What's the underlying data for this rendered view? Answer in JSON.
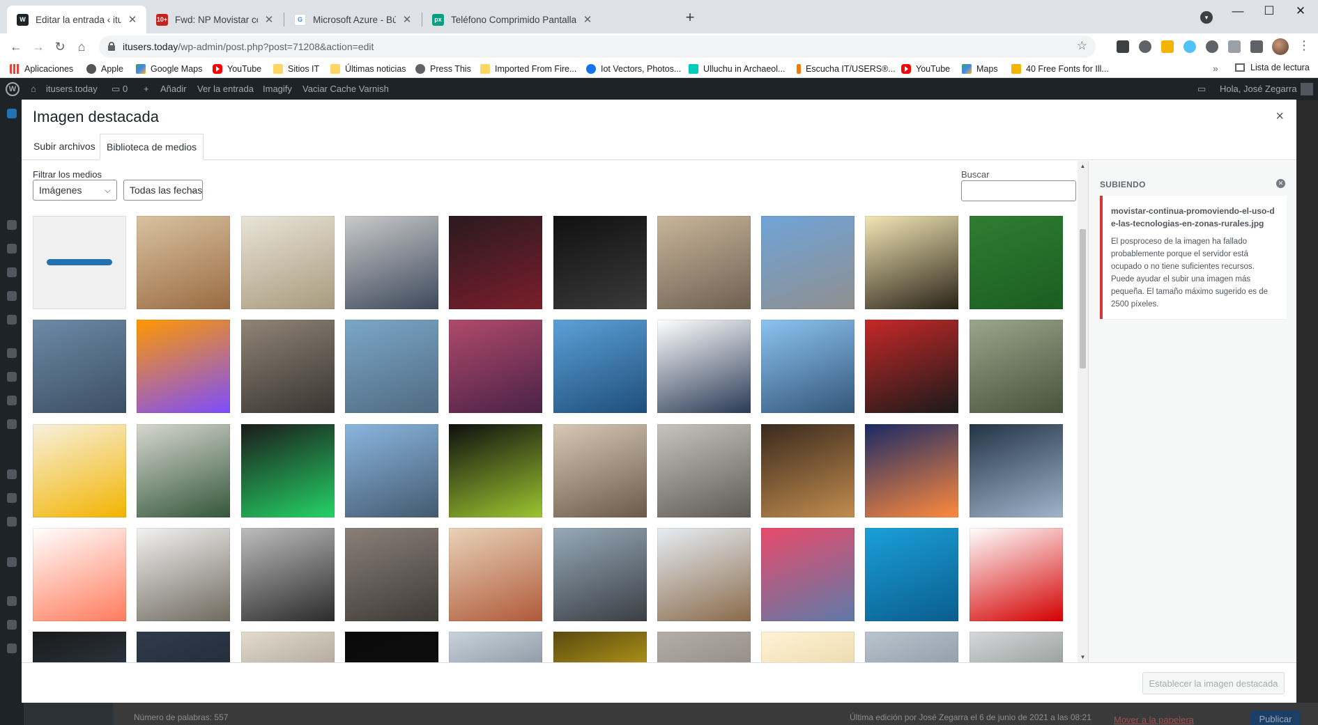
{
  "browser": {
    "tabs": [
      {
        "title": "Editar la entrada ‹ itusers.today",
        "favicon_color": "#1d2327",
        "favicon_text": "",
        "active": true
      },
      {
        "title": "Fwd: NP Movistar continúa promoviendo",
        "favicon_color": "#c5221f",
        "favicon_text": "10+",
        "active": false
      },
      {
        "title": "Microsoft Azure - Búsqueda de Google",
        "favicon_color": "#ffffff",
        "favicon_text": "G",
        "active": false
      },
      {
        "title": "Teléfono Comprimido Pantalla - Foto",
        "favicon_color": "#05a081",
        "favicon_text": "px",
        "active": false
      }
    ],
    "new_tab": "+",
    "window_controls": {
      "minimize": "—",
      "maximize": "☐",
      "close": "✕"
    },
    "url_host": "itusers.today",
    "url_path": "/wp-admin/post.php?post=71208&action=edit",
    "bookmarks": [
      {
        "label": "Aplicaciones",
        "icon": "apps"
      },
      {
        "label": "Apple",
        "icon": "apple"
      },
      {
        "label": "Google Maps",
        "icon": "maps"
      },
      {
        "label": "YouTube",
        "icon": "yt"
      },
      {
        "label": "Sitios IT",
        "icon": "folder"
      },
      {
        "label": "Últimas noticias",
        "icon": "folder"
      },
      {
        "label": "Press This",
        "icon": "globe"
      },
      {
        "label": "Imported From Fire...",
        "icon": "folder"
      },
      {
        "label": "Iot Vectors, Photos...",
        "icon": "freepik"
      },
      {
        "label": "Ulluchu in Archaeol...",
        "icon": "researchgate"
      },
      {
        "label": "Escucha IT/USERS®...",
        "icon": "ivoox"
      },
      {
        "label": "YouTube",
        "icon": "yt"
      },
      {
        "label": "Maps",
        "icon": "maps"
      },
      {
        "label": "40 Free Fonts for Ill...",
        "icon": "fonts"
      }
    ],
    "bookmarks_more": "»",
    "reading_list": "Lista de lectura"
  },
  "wp_admin": {
    "site_name": "itusers.today",
    "comments_count": "0",
    "add_new": "Añadir",
    "view_post": "Ver la entrada",
    "imagify": "Imagify",
    "varnish": "Vaciar Cache Varnish",
    "greeting": "Hola, José Zegarra",
    "word_count": "Número de palabras: 557",
    "last_edit": "Última edición por José Zegarra el 6 de junio de 2021 a las 08:21",
    "trash": "Mover a la papelera",
    "publish": "Publicar"
  },
  "modal": {
    "title": "Imagen destacada",
    "close": "×",
    "tabs": [
      "Subir archivos",
      "Biblioteca de medios"
    ],
    "active_tab": 1,
    "filter_label": "Filtrar los medios",
    "type_filter": "Imágenes",
    "date_filter": "Todas las fechas",
    "search_label": "Buscar",
    "search_value": "",
    "set_button": "Establecer la imagen destacada"
  },
  "upload_panel": {
    "heading": "SUBIENDO",
    "filename": "movistar-continua-promoviendo-el-uso-de-las-tecnologias-en-zonas-rurales.jpg",
    "message": "El posproceso de la imagen ha fallado probablemente porque el servidor está ocupado o no tiene suficientes recursos. Puede ayudar el subir una imagen más pequeña. El tamaño máximo sugerido es de 2500 píxeles."
  },
  "media_items": [
    {
      "subject": "loading-bar",
      "colors": [
        "#f0f0f1",
        "#f0f0f1"
      ]
    },
    {
      "subject": "desk-with-phones",
      "colors": [
        "#d9c2a0",
        "#9a6b42"
      ]
    },
    {
      "subject": "boy-with-laptop",
      "colors": [
        "#e9e4d8",
        "#a89a7d"
      ]
    },
    {
      "subject": "man-portrait",
      "colors": [
        "#c9c9c9",
        "#3d4a5c"
      ]
    },
    {
      "subject": "man-with-phone-icons",
      "colors": [
        "#2a1a20",
        "#7a1e2b"
      ]
    },
    {
      "subject": "hand-touching-icons",
      "colors": [
        "#111111",
        "#3a3a3a"
      ]
    },
    {
      "subject": "aerial-city-smoke",
      "colors": [
        "#c9b59a",
        "#6e6052"
      ]
    },
    {
      "subject": "sap-building",
      "colors": [
        "#6fa3d8",
        "#8f8f8f"
      ]
    },
    {
      "subject": "photographer-silhouette",
      "colors": [
        "#f3e6b5",
        "#2a2418"
      ]
    },
    {
      "subject": "amazon-river",
      "colors": [
        "#2e7d32",
        "#1b5e20"
      ]
    },
    {
      "subject": "man-climbing",
      "colors": [
        "#6d8aa8",
        "#3c4f63"
      ]
    },
    {
      "subject": "iot-bubbles",
      "colors": [
        "#ff9800",
        "#7c4dff"
      ]
    },
    {
      "subject": "classroom",
      "colors": [
        "#8f8477",
        "#3a3530"
      ]
    },
    {
      "subject": "industrial-workers",
      "colors": [
        "#7aa7c7",
        "#506a82"
      ]
    },
    {
      "subject": "woman-purple",
      "colors": [
        "#b04a6a",
        "#4a2248"
      ]
    },
    {
      "subject": "glass-building",
      "colors": [
        "#5ca0d8",
        "#1e4f7a"
      ]
    },
    {
      "subject": "utec-hand-pen",
      "colors": [
        "#ffffff",
        "#2a3a55"
      ]
    },
    {
      "subject": "skyscrapers-sky",
      "colors": [
        "#8cc3f0",
        "#34567a"
      ]
    },
    {
      "subject": "red-ram-modules",
      "colors": [
        "#c62828",
        "#1a1a1a"
      ]
    },
    {
      "subject": "utec-robot-room",
      "colors": [
        "#9aa58a",
        "#49523d"
      ]
    },
    {
      "subject": "hands-yellow-line",
      "colors": [
        "#f7f0de",
        "#f2b400"
      ]
    },
    {
      "subject": "woman-green-sculpture",
      "colors": [
        "#d7d7cf",
        "#33573a"
      ]
    },
    {
      "subject": "app-icons",
      "colors": [
        "#1b1b1b",
        "#25d366"
      ]
    },
    {
      "subject": "shanghai-skyline",
      "colors": [
        "#8ab6e0",
        "#445a70"
      ]
    },
    {
      "subject": "motherboard",
      "colors": [
        "#0f0f0f",
        "#9bc530"
      ]
    },
    {
      "subject": "office-meeting",
      "colors": [
        "#d7c8b5",
        "#6b5a48"
      ]
    },
    {
      "subject": "desk-telephone",
      "colors": [
        "#c7c4c0",
        "#5e5a56"
      ]
    },
    {
      "subject": "woman-on-screen",
      "colors": [
        "#3a2a1e",
        "#c28c4e"
      ]
    },
    {
      "subject": "city-night",
      "colors": [
        "#1a2a66",
        "#ff8a3d"
      ]
    },
    {
      "subject": "server-rack",
      "colors": [
        "#243447",
        "#9fb4c9"
      ]
    },
    {
      "subject": "insights-infographic",
      "colors": [
        "#ffffff",
        "#ff7b5c"
      ]
    },
    {
      "subject": "utec-collage",
      "colors": [
        "#f2f2f2",
        "#6f6a5e"
      ]
    },
    {
      "subject": "boy-bw-portrait",
      "colors": [
        "#bdbdbd",
        "#2b2b2b"
      ]
    },
    {
      "subject": "woman-hood-smoking",
      "colors": [
        "#8a8078",
        "#3f3a36"
      ]
    },
    {
      "subject": "woman-reading",
      "colors": [
        "#e8d2b8",
        "#b05a3a"
      ]
    },
    {
      "subject": "people-on-rocks",
      "colors": [
        "#96a9b8",
        "#3a3f44"
      ]
    },
    {
      "subject": "smiling-women",
      "colors": [
        "#e6edf4",
        "#8a6a4a"
      ]
    },
    {
      "subject": "men-red-car",
      "colors": [
        "#e84a6a",
        "#5e7aa8"
      ]
    },
    {
      "subject": "seidor-sap-aws",
      "colors": [
        "#1aa0d8",
        "#0b5d8f"
      ]
    },
    {
      "subject": "huawei-man",
      "colors": [
        "#ffffff",
        "#d40000"
      ]
    },
    {
      "subject": "man-dark",
      "colors": [
        "#1a1a1a",
        "#3a4a5a"
      ]
    },
    {
      "subject": "cloud-diagram",
      "colors": [
        "#2f3b4a",
        "#1a2430"
      ]
    },
    {
      "subject": "lamp-room",
      "colors": [
        "#e2dccf",
        "#8a7f6e"
      ]
    },
    {
      "subject": "black-image",
      "colors": [
        "#0a0a0a",
        "#101010"
      ]
    },
    {
      "subject": "laptop-desk",
      "colors": [
        "#c8d2dc",
        "#5e6a78"
      ]
    },
    {
      "subject": "yellow-light",
      "colors": [
        "#5a4a10",
        "#f5d020"
      ]
    },
    {
      "subject": "check-button",
      "colors": [
        "#b5aea6",
        "#7a736c"
      ]
    },
    {
      "subject": "sunlight-glow",
      "colors": [
        "#fff3d6",
        "#e0c48a"
      ]
    },
    {
      "subject": "cloudy-landscape",
      "colors": [
        "#b9c4cf",
        "#707c88"
      ]
    },
    {
      "subject": "outdoor-trees",
      "colors": [
        "#d4d8dc",
        "#6a6e62"
      ]
    }
  ]
}
